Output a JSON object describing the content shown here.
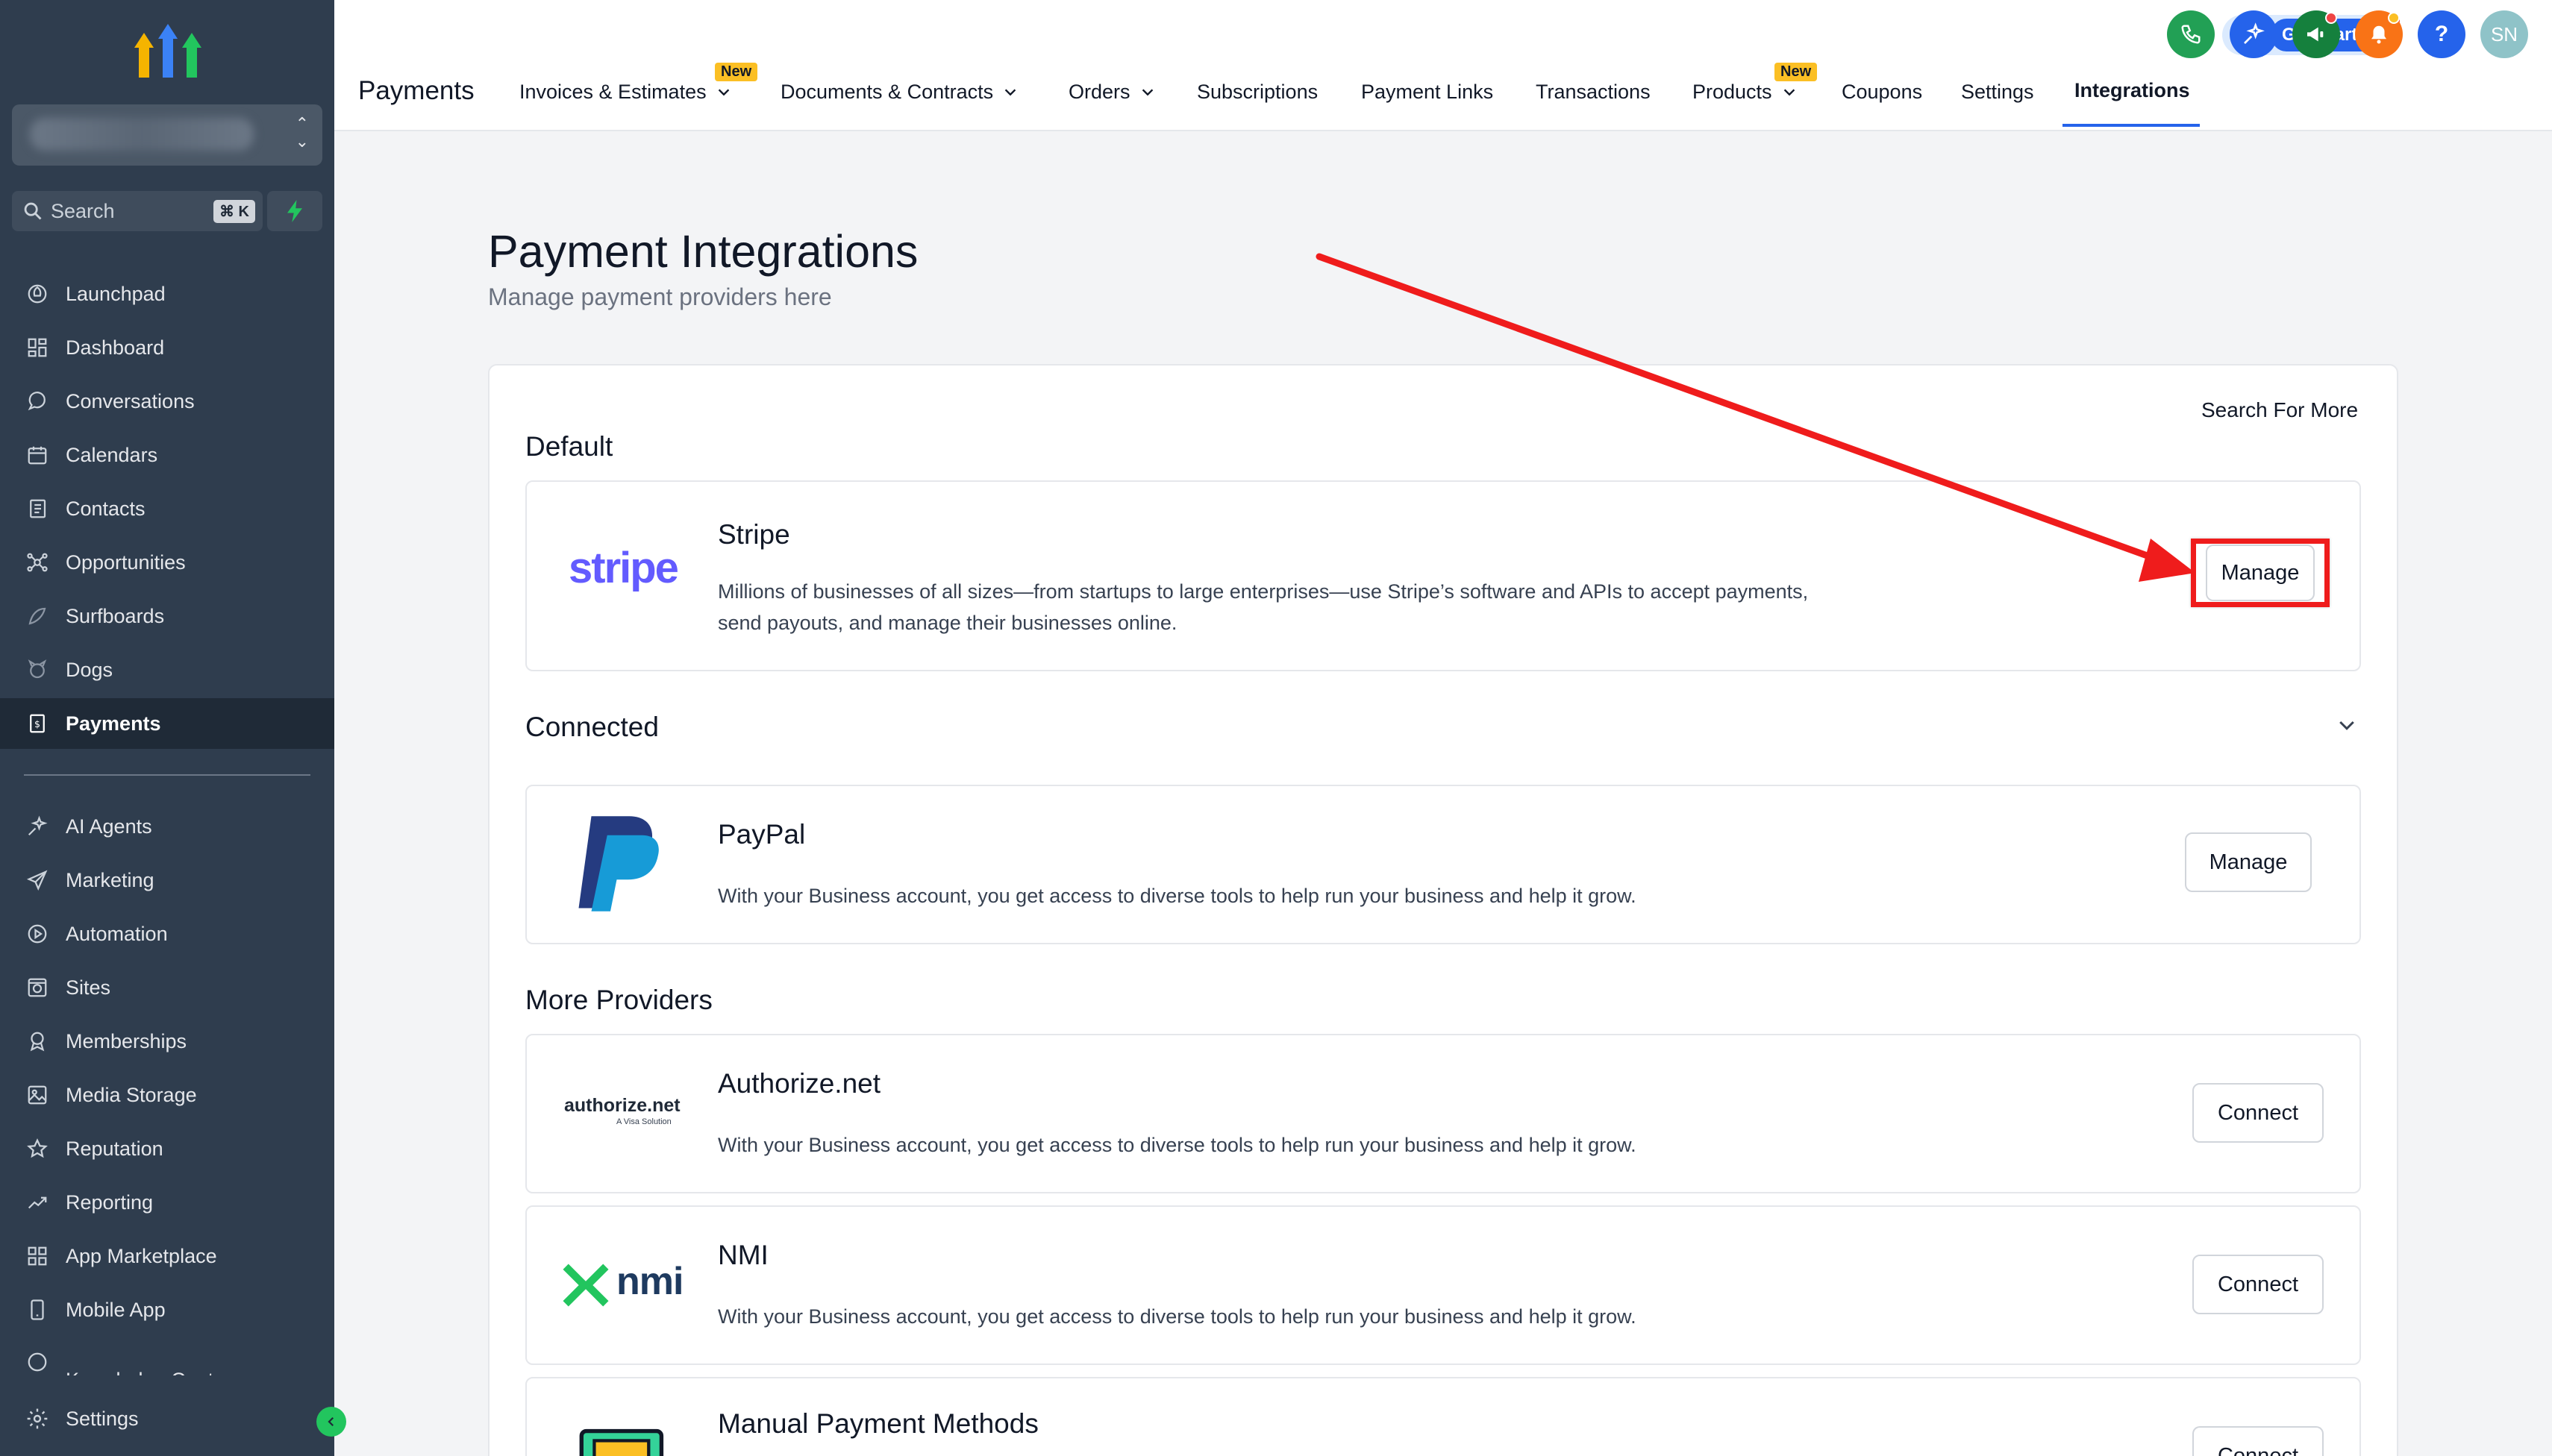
{
  "sidebar": {
    "search_label": "Search",
    "search_kbd": "⌘ K",
    "items": [
      {
        "label": "Launchpad",
        "icon": "rocket-icon"
      },
      {
        "label": "Dashboard",
        "icon": "dashboard-grid-icon"
      },
      {
        "label": "Conversations",
        "icon": "chat-bubble-icon"
      },
      {
        "label": "Calendars",
        "icon": "calendar-icon"
      },
      {
        "label": "Contacts",
        "icon": "contacts-book-icon"
      },
      {
        "label": "Opportunities",
        "icon": "opportunities-network-icon"
      },
      {
        "label": "Surfboards",
        "icon": "surfboard-icon"
      },
      {
        "label": "Dogs",
        "icon": "dog-icon"
      },
      {
        "label": "Payments",
        "icon": "payments-receipt-icon"
      },
      {
        "label": "AI Agents",
        "icon": "sparkles-icon"
      },
      {
        "label": "Marketing",
        "icon": "send-plane-icon"
      },
      {
        "label": "Automation",
        "icon": "automation-play-icon"
      },
      {
        "label": "Sites",
        "icon": "sites-globe-icon"
      },
      {
        "label": "Memberships",
        "icon": "membership-badge-icon"
      },
      {
        "label": "Media Storage",
        "icon": "image-icon"
      },
      {
        "label": "Reputation",
        "icon": "star-icon"
      },
      {
        "label": "Reporting",
        "icon": "trend-line-icon"
      },
      {
        "label": "App Marketplace",
        "icon": "app-grid-icon"
      },
      {
        "label": "Mobile App",
        "icon": "mobile-phone-icon"
      },
      {
        "label": "Knowledge Center",
        "icon": "knowledge-icon"
      }
    ],
    "active_item": "Payments",
    "settings_label": "Settings"
  },
  "header": {
    "title": "Payments",
    "tabs": [
      {
        "label": "Invoices & Estimates",
        "has_dropdown": true,
        "badge": "New"
      },
      {
        "label": "Documents & Contracts",
        "has_dropdown": true
      },
      {
        "label": "Orders",
        "has_dropdown": true
      },
      {
        "label": "Subscriptions"
      },
      {
        "label": "Payment Links"
      },
      {
        "label": "Transactions"
      },
      {
        "label": "Products",
        "has_dropdown": true,
        "badge": "New"
      },
      {
        "label": "Coupons"
      },
      {
        "label": "Settings"
      },
      {
        "label": "Integrations",
        "active": true
      }
    ],
    "get_started_label": "Get Started",
    "avatar_initials": "SN",
    "help_label": "?"
  },
  "main": {
    "title": "Payment Integrations",
    "subtitle": "Manage payment providers here",
    "search_more": "Search For More",
    "sections": {
      "default": "Default",
      "connected": "Connected",
      "more": "More Providers"
    },
    "providers": {
      "stripe": {
        "logo_text": "stripe",
        "name": "Stripe",
        "desc": "Millions of businesses of all sizes—from startups to large enterprises—use Stripe’s software and APIs to accept payments, send payouts, and manage their businesses online.",
        "action": "Manage"
      },
      "paypal": {
        "name": "PayPal",
        "desc": "With your Business account, you get access to diverse tools to help run your business and help it grow.",
        "action": "Manage"
      },
      "authorize": {
        "logo_text": "authorize.net",
        "logo_sub": "A Visa Solution",
        "name": "Authorize.net",
        "desc": "With your Business account, you get access to diverse tools to help run your business and help it grow.",
        "action": "Connect"
      },
      "nmi": {
        "logo_text": "nmi",
        "name": "NMI",
        "desc": "With your Business account, you get access to diverse tools to help run your business and help it grow.",
        "action": "Connect"
      },
      "manual": {
        "name": "Manual Payment Methods",
        "action": "Connect"
      }
    }
  },
  "colors": {
    "sidebar_bg": "#2f3d4e",
    "accent_blue": "#2563eb",
    "highlight_red": "#ef1c1c",
    "stripe_purple": "#635bff"
  }
}
